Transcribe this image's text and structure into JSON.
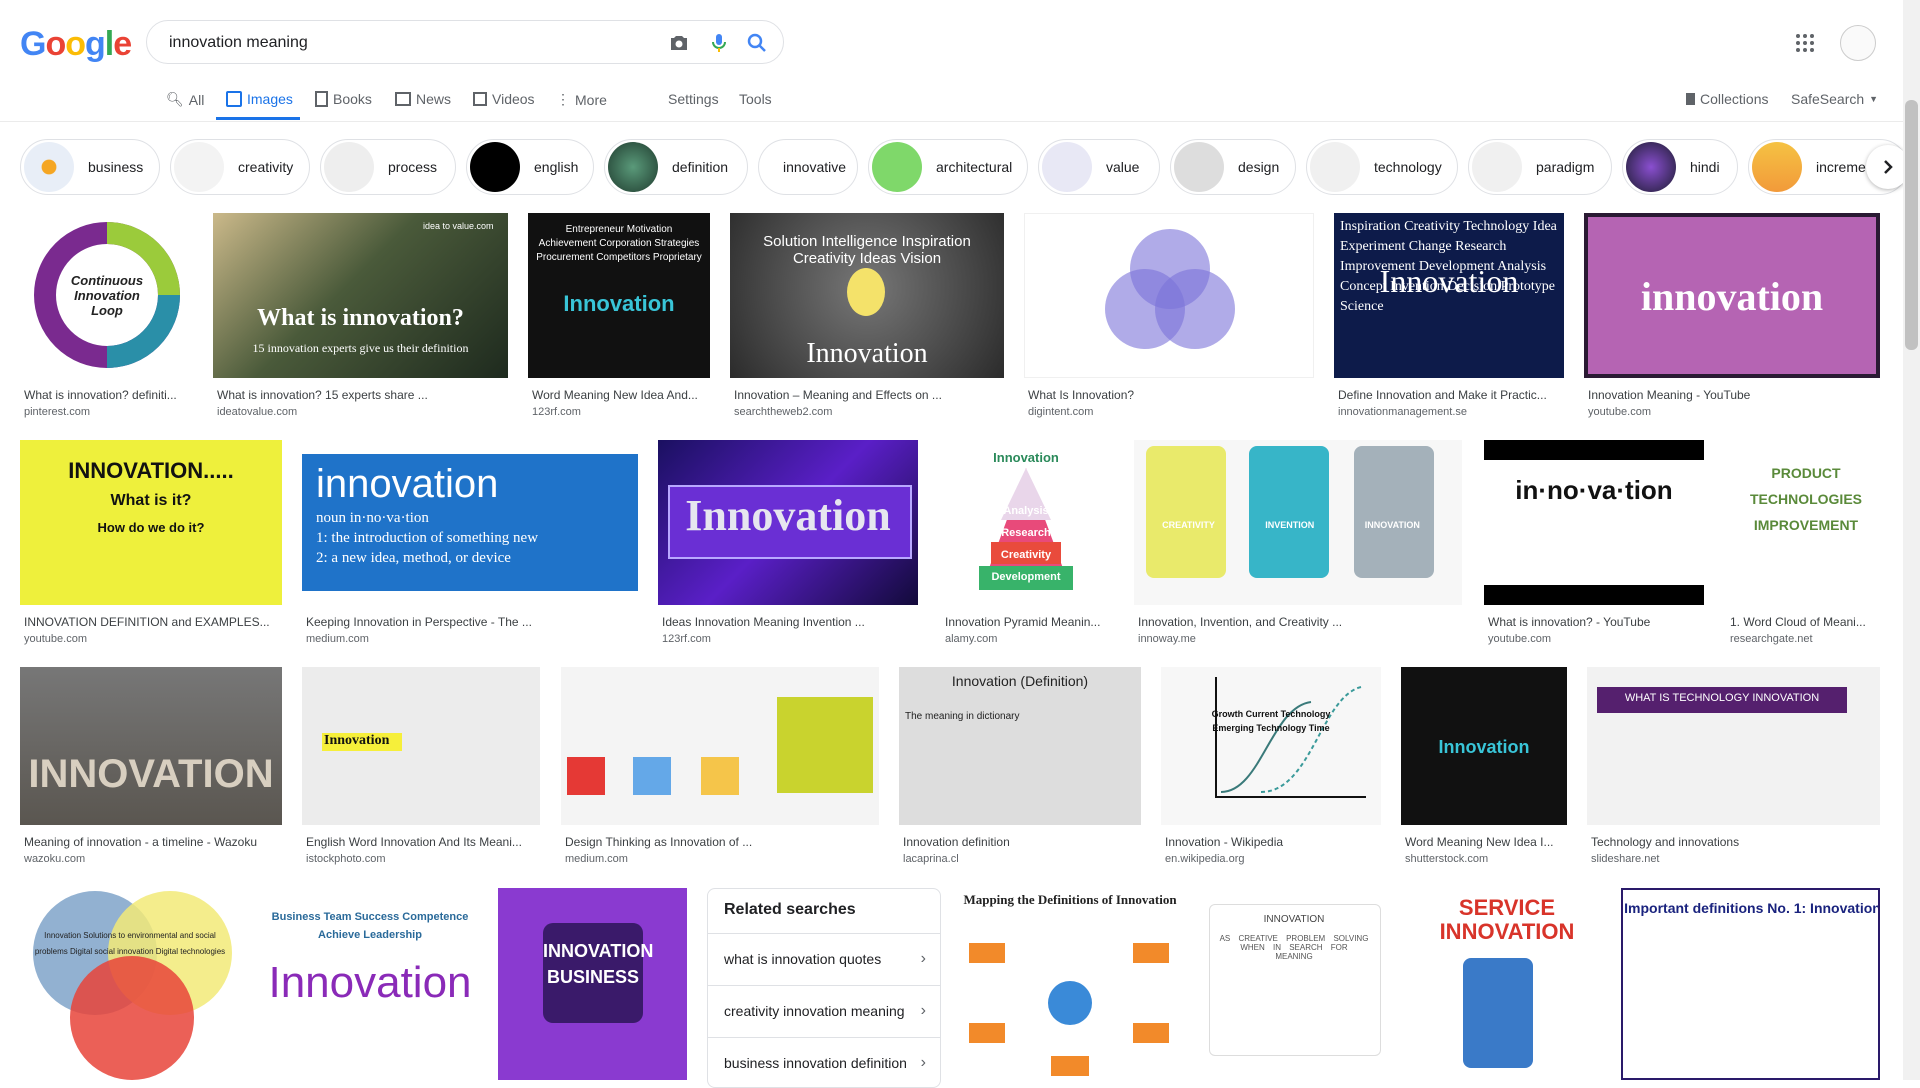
{
  "logo": {
    "letters": [
      "G",
      "o",
      "o",
      "g",
      "l",
      "e"
    ]
  },
  "search": {
    "value": "innovation meaning"
  },
  "header": {
    "apps_icon": "apps-grid-icon",
    "avatar": "account-avatar"
  },
  "tabs": {
    "all": "All",
    "images": "Images",
    "books": "Books",
    "news": "News",
    "videos": "Videos",
    "more": "More",
    "settings": "Settings",
    "tools": "Tools",
    "collections": "Collections",
    "safesearch": "SafeSearch"
  },
  "chips": [
    {
      "label": "business"
    },
    {
      "label": "creativity"
    },
    {
      "label": "process"
    },
    {
      "label": "english"
    },
    {
      "label": "definition"
    },
    {
      "label": "innovative"
    },
    {
      "label": "architectural"
    },
    {
      "label": "value"
    },
    {
      "label": "design"
    },
    {
      "label": "technology"
    },
    {
      "label": "paradigm"
    },
    {
      "label": "hindi"
    },
    {
      "label": "incremen"
    }
  ],
  "results": [
    {
      "title": "What is innovation? definiti...",
      "domain": "pinterest.com",
      "img_text": "Continuous Innovation Loop"
    },
    {
      "title": "What is innovation? 15 experts share ...",
      "domain": "ideatovalue.com",
      "img_text": "What is innovation?",
      "img_sub": "15 innovation experts give us their definition",
      "img_brand": "idea to value.com"
    },
    {
      "title": "Word Meaning New Idea And...",
      "domain": "123rf.com",
      "img_text": "Innovation",
      "img_words": "Entrepreneur Motivation Achievement Corporation Strategies Procurement Competitors Proprietary"
    },
    {
      "title": "Innovation – Meaning and Effects on ...",
      "domain": "searchtheweb2.com",
      "img_text": "Innovation",
      "img_words": "Solution Intelligence Inspiration Creativity Ideas Vision"
    },
    {
      "title": "What Is Innovation?",
      "domain": "digintent.com"
    },
    {
      "title": "Define Innovation and Make it Practic...",
      "domain": "innovationmanagement.se",
      "img_text": "Innovation",
      "img_words": "Inspiration Creativity Technology Idea Experiment Change Research Improvement Development Analysis Concept Invention Decision Prototype Science"
    },
    {
      "title": "Innovation Meaning - YouTube",
      "domain": "youtube.com",
      "img_text": "innovation"
    },
    {
      "title": "INNOVATION DEFINITION and EXAMPLES...",
      "domain": "youtube.com",
      "img_text": "INNOVATION.....",
      "img_sub": "What is it?",
      "img_sub2": "How do we do it?"
    },
    {
      "title": "Keeping Innovation in Perspective - The ...",
      "domain": "medium.com",
      "img_text": "innovation",
      "img_sub": "noun   in·no·va·tion",
      "img_sub2": "1: the introduction of something new",
      "img_sub3": "2: a new idea, method, or device"
    },
    {
      "title": "Ideas Innovation Meaning Invention ...",
      "domain": "123rf.com",
      "img_text": "Innovation"
    },
    {
      "title": "Innovation Pyramid Meanin...",
      "domain": "alamy.com",
      "img_text": "Innovation",
      "img_words": "Analysis Research Creativity Development"
    },
    {
      "title": "Innovation, Invention, and Creativity ...",
      "domain": "innoway.me",
      "img_words": "CREATIVITY INVENTION INNOVATION"
    },
    {
      "title": "What is innovation? - YouTube",
      "domain": "youtube.com",
      "img_text": "in·no·va·tion"
    },
    {
      "title": "1. Word Cloud of Meani...",
      "domain": "researchgate.net",
      "img_words": "PRODUCT TECHNOLOGIES IMPROVEMENT"
    },
    {
      "title": "Meaning of innovation - a timeline - Wazoku",
      "domain": "wazoku.com",
      "img_text": "INNOVATION"
    },
    {
      "title": "English Word Innovation And Its Meani...",
      "domain": "istockphoto.com",
      "img_text": "Innovation"
    },
    {
      "title": "Design Thinking as Innovation of ...",
      "domain": "medium.com"
    },
    {
      "title": "Innovation definition",
      "domain": "lacaprina.cl",
      "img_text": "Innovation (Definition)",
      "img_sub": "The meaning in dictionary"
    },
    {
      "title": "Innovation - Wikipedia",
      "domain": "en.wikipedia.org",
      "img_words": "Growth Current Technology Emerging Technology Time"
    },
    {
      "title": "Word Meaning New Idea I...",
      "domain": "shutterstock.com",
      "img_text": "Innovation"
    },
    {
      "title": "Technology and innovations",
      "domain": "slideshare.net",
      "img_text": "WHAT IS TECHNOLOGY INNOVATION"
    },
    {
      "img_words": "Innovation Solutions to environmental and social problems Digital social innovation Digital technologies"
    },
    {
      "img_text": "Innovation",
      "img_words": "Business Team Success Competence Achieve Leadership"
    },
    {
      "img_text": "INNOVATION BUSINESS"
    },
    {
      "img_text": "Mapping the Definitions of Innovation"
    },
    {
      "img_text": "INNOVATION",
      "img_words": "AS CREATIVE PROBLEM SOLVING WHEN IN SEARCH FOR MEANING"
    },
    {
      "img_text": "SERVICE INNOVATION"
    },
    {
      "img_text": "Important definitions No. 1: Innovation"
    }
  ],
  "related": {
    "title": "Related searches",
    "items": [
      {
        "label": "what is innovation quotes"
      },
      {
        "label": "creativity innovation meaning"
      },
      {
        "label": "business innovation definition"
      }
    ]
  },
  "colors": {
    "accent": "#1a73e8",
    "link": "#3c4043",
    "muted": "#5f6368"
  }
}
